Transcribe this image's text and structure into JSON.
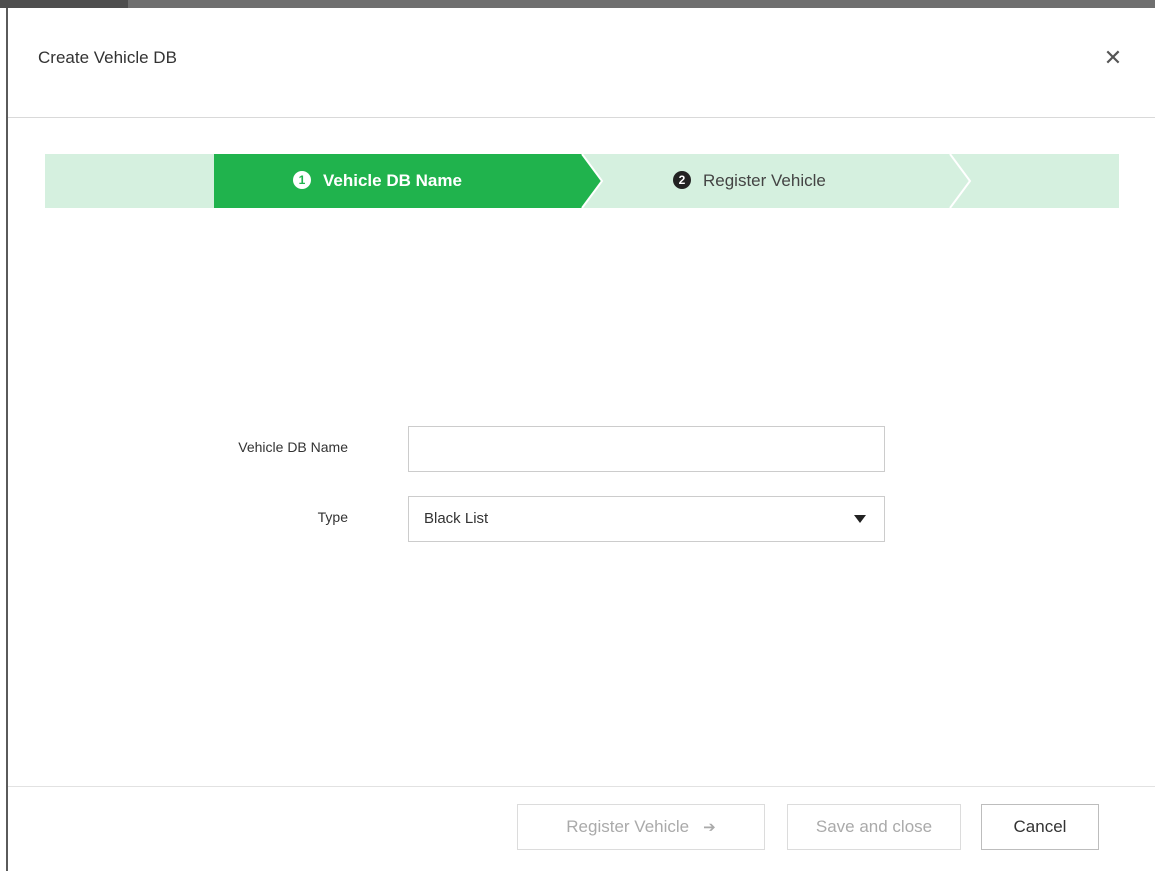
{
  "dialog": {
    "title": "Create Vehicle DB",
    "close_icon": "close-icon"
  },
  "stepper": {
    "steps": [
      {
        "number": "1",
        "label": "Vehicle DB Name",
        "active": true
      },
      {
        "number": "2",
        "label": "Register Vehicle",
        "active": false
      }
    ],
    "active_color": "#20b34d",
    "inactive_color": "#d5f0df"
  },
  "form": {
    "name_label": "Vehicle DB Name",
    "name_value": "",
    "type_label": "Type",
    "type_value": "Black List"
  },
  "footer": {
    "register_label": "Register Vehicle",
    "save_label": "Save and close",
    "cancel_label": "Cancel"
  },
  "icons": {
    "close": "close-icon",
    "dropdown": "caret-down-icon",
    "next": "arrow-right-icon"
  }
}
